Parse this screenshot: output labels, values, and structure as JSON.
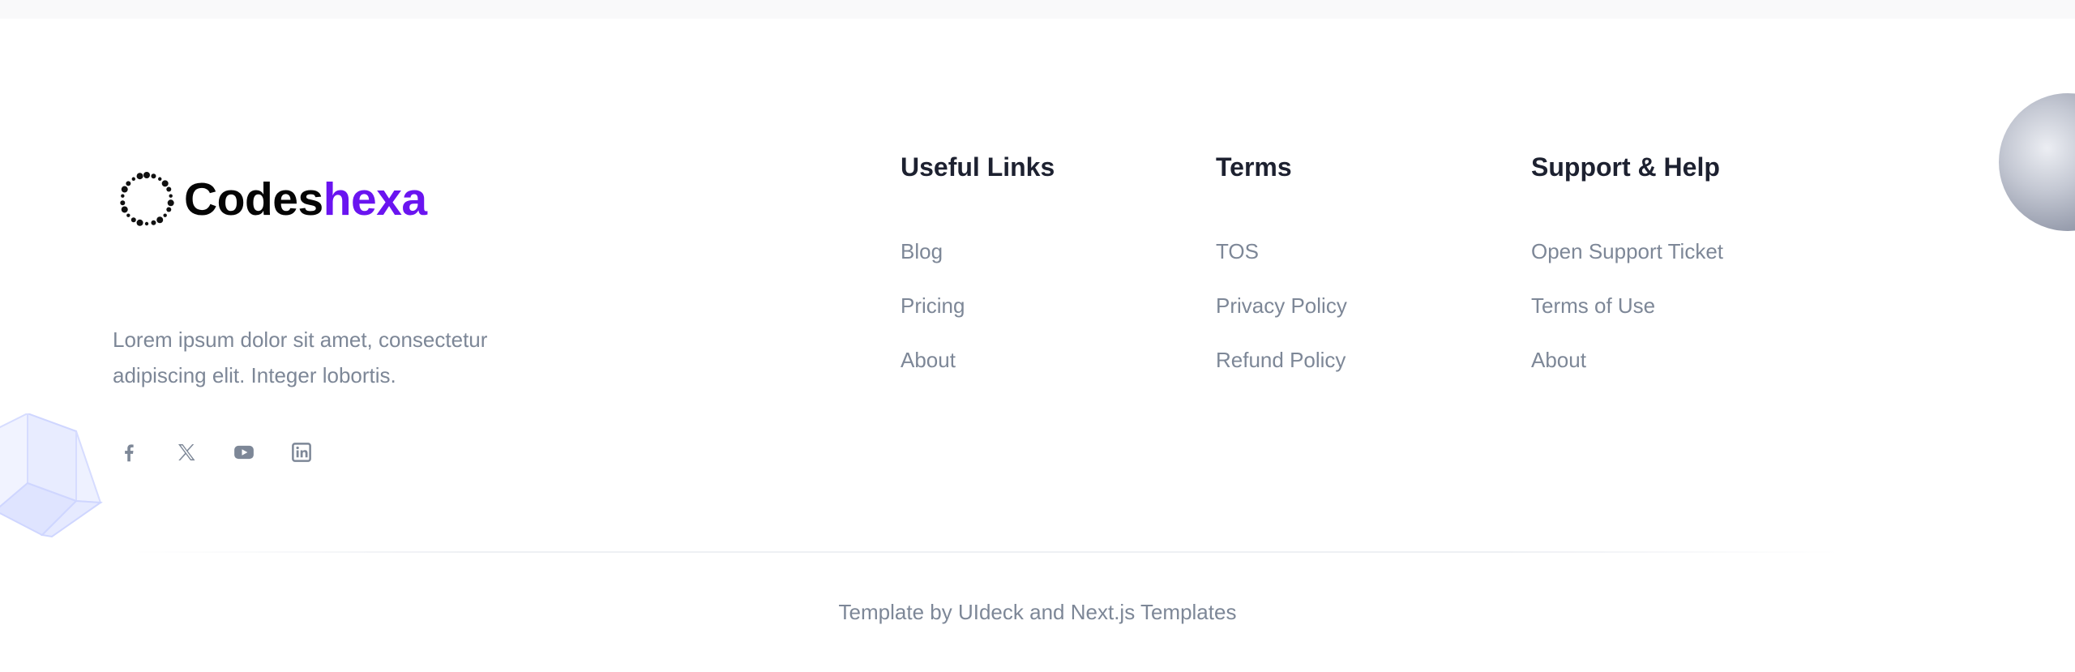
{
  "brand": {
    "name_part1": "Codes",
    "name_part2": "hexa",
    "accent_color": "#6a14f0",
    "icon": "dotted-ring-logo-icon"
  },
  "about": {
    "description": "Lorem ipsum dolor sit amet, consectetur adipiscing elit. Integer lobortis."
  },
  "socials": [
    {
      "name": "facebook",
      "icon": "facebook-icon"
    },
    {
      "name": "x",
      "icon": "x-icon"
    },
    {
      "name": "youtube",
      "icon": "youtube-icon"
    },
    {
      "name": "linkedin",
      "icon": "linkedin-icon"
    }
  ],
  "columns": [
    {
      "title": "Useful Links",
      "links": [
        "Blog",
        "Pricing",
        "About"
      ]
    },
    {
      "title": "Terms",
      "links": [
        "TOS",
        "Privacy Policy",
        "Refund Policy"
      ]
    },
    {
      "title": "Support & Help",
      "links": [
        "Open Support Ticket",
        "Terms of Use",
        "About"
      ]
    }
  ],
  "credit": {
    "prefix": "Template by",
    "link1": "UIdeck",
    "middle": "and",
    "link2": "Next.js Templates"
  },
  "colors": {
    "heading": "#1d2130",
    "muted": "#7d8797",
    "background": "#ffffff"
  }
}
